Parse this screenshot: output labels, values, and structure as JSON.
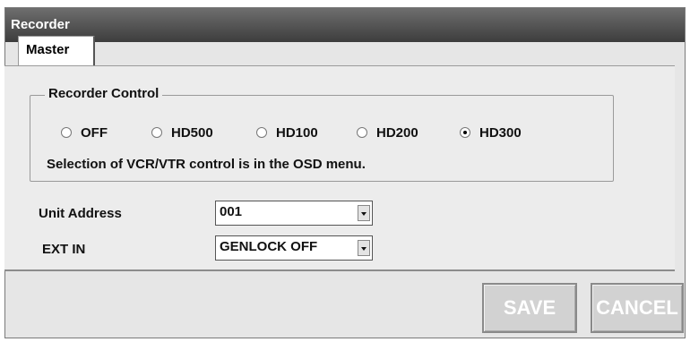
{
  "window": {
    "title": "Recorder"
  },
  "tabs": [
    {
      "label": "Master"
    }
  ],
  "recorder_control": {
    "label": "Recorder Control",
    "options": [
      {
        "label": "OFF",
        "selected": false
      },
      {
        "label": "HD500",
        "selected": false
      },
      {
        "label": "HD100",
        "selected": false
      },
      {
        "label": "HD200",
        "selected": false
      },
      {
        "label": "HD300",
        "selected": true
      }
    ],
    "note": "Selection of VCR/VTR control is in the OSD menu."
  },
  "unit_address": {
    "label": "Unit Address",
    "value": "001"
  },
  "ext_in": {
    "label": "EXT IN",
    "value": "GENLOCK OFF"
  },
  "buttons": {
    "save": "SAVE",
    "cancel": "CANCEL"
  },
  "icons": {
    "dropdown": "chevron-down-icon",
    "radio": "radio-button-icon"
  }
}
